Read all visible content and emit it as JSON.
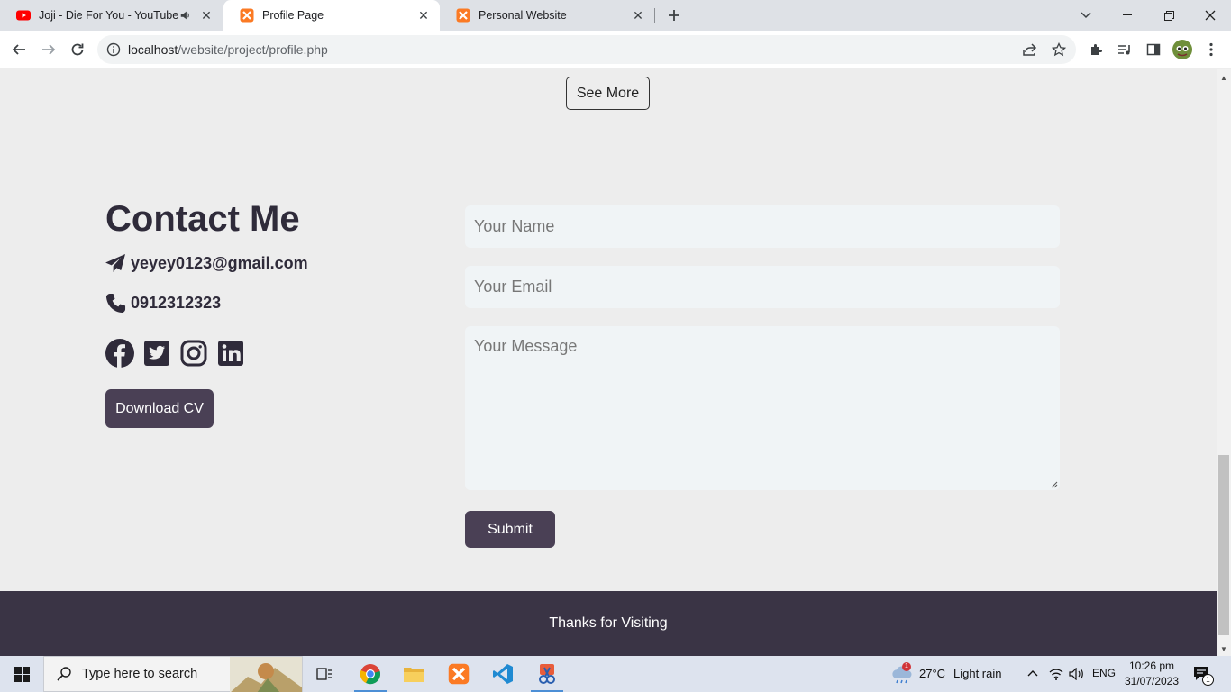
{
  "browser": {
    "tabs": [
      {
        "title": "Joji - Die For You - YouTube",
        "audio_icon": "speaker-icon",
        "active": false
      },
      {
        "title": "Profile Page",
        "active": true
      },
      {
        "title": "Personal Website",
        "active": false
      }
    ],
    "url_host": "localhost",
    "url_path": "/website/project/profile.php"
  },
  "page": {
    "see_more": "See More",
    "contact_title": "Contact Me",
    "email": "yeyey0123@gmail.com",
    "phone": "0912312323",
    "socials": [
      "facebook-icon",
      "twitter-icon",
      "instagram-icon",
      "linkedin-icon"
    ],
    "download_cv": "Download CV",
    "form": {
      "name_placeholder": "Your Name",
      "email_placeholder": "Your Email",
      "message_placeholder": "Your Message",
      "submit": "Submit"
    },
    "footer_text": "Thanks for Visiting"
  },
  "taskbar": {
    "search_placeholder": "Type here to search",
    "weather_temp": "27°C",
    "weather_desc": "Light rain",
    "weather_badge": "1",
    "language": "ENG",
    "time": "10:26 pm",
    "date": "31/07/2023",
    "notification_count": "1"
  },
  "colors": {
    "accent_dark": "#4a4055",
    "footer_bg": "#3a3445",
    "page_bg": "#ededed"
  }
}
